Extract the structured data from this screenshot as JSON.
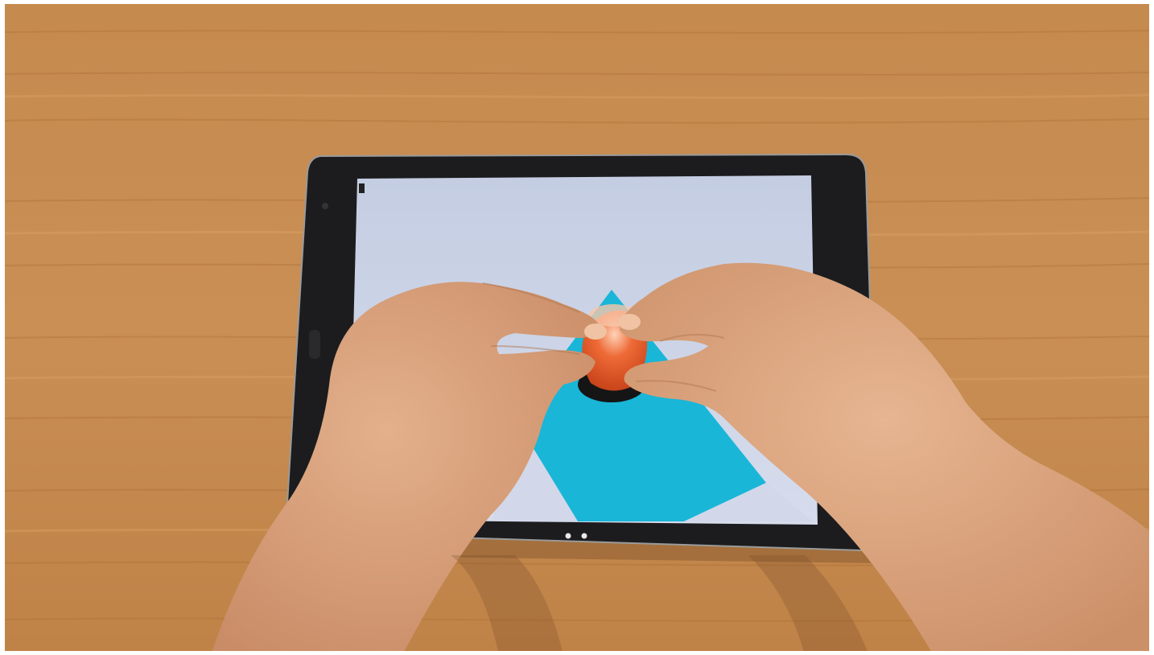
{
  "scene": {
    "surface": "wooden-table",
    "device": "tablet",
    "device_orientation": "landscape",
    "screen_content": "3d-sculpting-view",
    "palette": {
      "wood": "#c98c4f",
      "wood_dark": "#a86d35",
      "bezel": "#1c1c1e",
      "screen_sky": "#c9d2e6",
      "floor_plane": "#19b6d8",
      "object_orange": "#e85a2a",
      "skin": "#d9a07a"
    }
  },
  "icons": {
    "status": "battery-icon",
    "nav": "page-dots-icon"
  }
}
